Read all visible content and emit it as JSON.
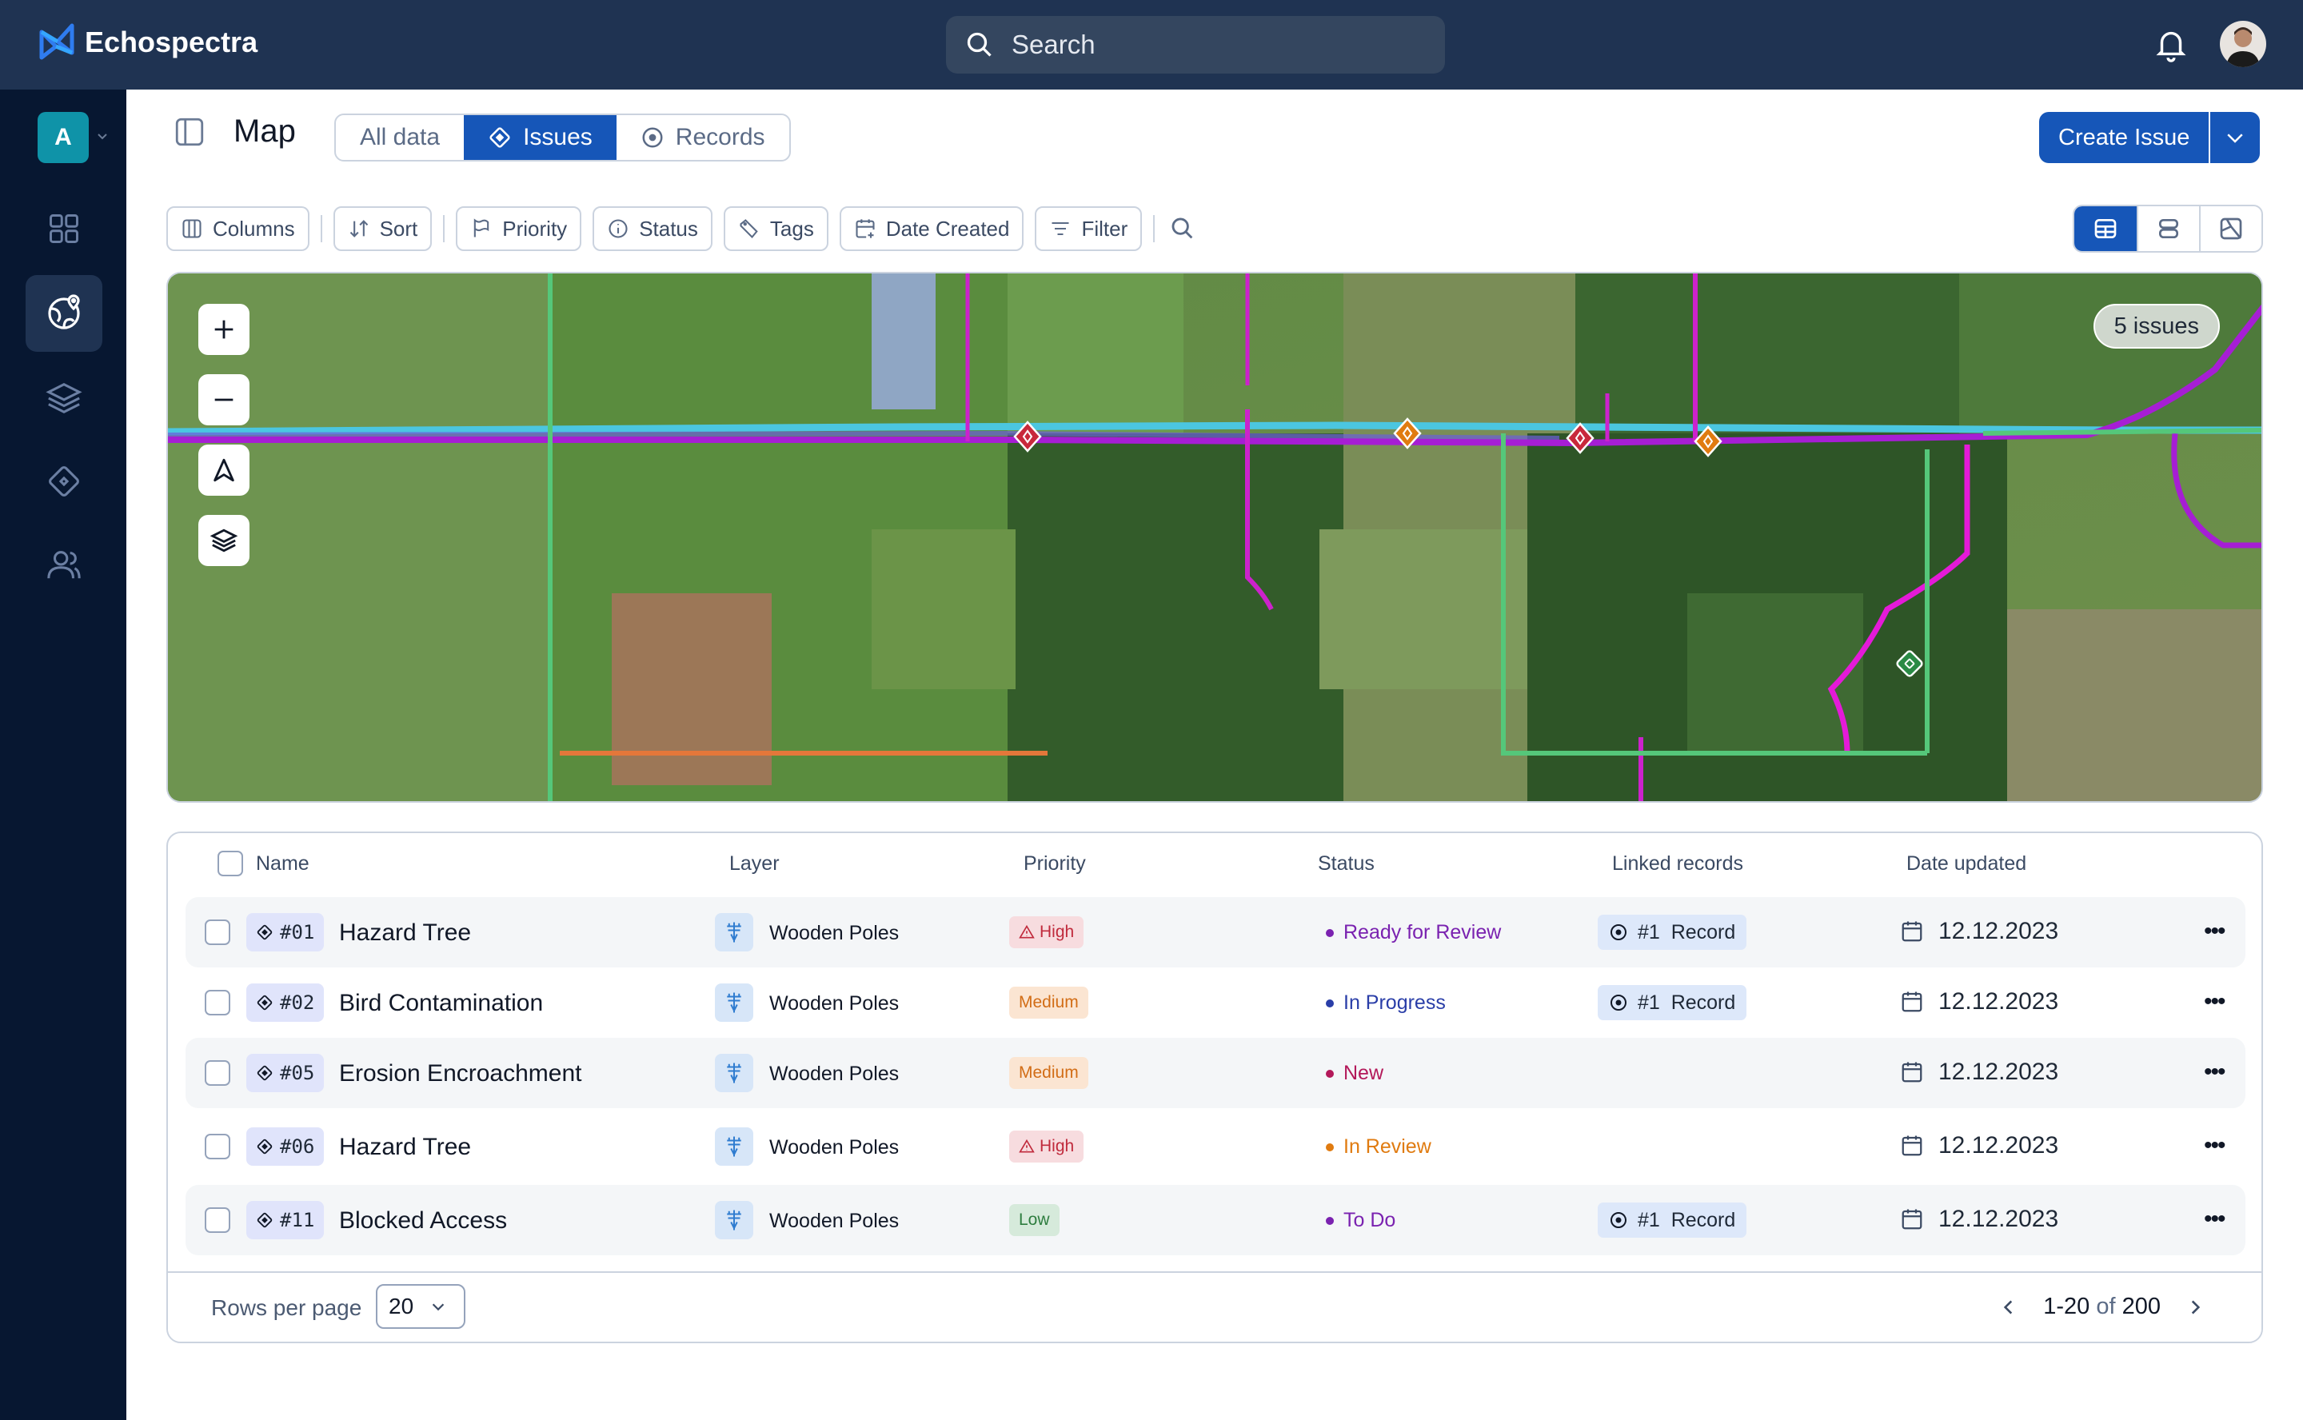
{
  "app": {
    "name": "Echospectra"
  },
  "topbar": {
    "search_placeholder": "Search"
  },
  "sidebar": {
    "workspace_initial": "A",
    "items": [
      {
        "name": "dashboard",
        "icon": "grid-icon",
        "active": false
      },
      {
        "name": "map",
        "icon": "globe-pin-icon",
        "active": true
      },
      {
        "name": "layers",
        "icon": "layers-icon",
        "active": false
      },
      {
        "name": "issues",
        "icon": "diamond-icon",
        "active": false
      },
      {
        "name": "users",
        "icon": "users-icon",
        "active": false
      }
    ]
  },
  "header": {
    "title": "Map",
    "tabs": [
      {
        "label": "All data",
        "active": false
      },
      {
        "label": "Issues",
        "active": true,
        "icon": "diamond-icon"
      },
      {
        "label": "Records",
        "active": false,
        "icon": "target-icon"
      }
    ],
    "create_button": "Create Issue"
  },
  "filters": {
    "columns": "Columns",
    "sort": "Sort",
    "priority": "Priority",
    "status": "Status",
    "tags": "Tags",
    "date_created": "Date Created",
    "filter": "Filter"
  },
  "map": {
    "issue_count_label": "5 issues",
    "markers": [
      {
        "priority": "high",
        "color": "#c8293b"
      },
      {
        "priority": "medium",
        "color": "#e07b10"
      },
      {
        "priority": "high",
        "color": "#c8293b"
      },
      {
        "priority": "medium",
        "color": "#e07b10"
      },
      {
        "priority": "low",
        "color": "#2a8a45"
      }
    ]
  },
  "table": {
    "columns": [
      "Name",
      "Layer",
      "Priority",
      "Status",
      "Linked records",
      "Date updated"
    ],
    "rows": [
      {
        "id": "#01",
        "name": "Hazard Tree",
        "layer": "Wooden Poles",
        "priority": "High",
        "priority_level": "high",
        "status": "Ready for Review",
        "status_color": "#7a22b0",
        "linked": "#1  Record",
        "date": "12.12.2023"
      },
      {
        "id": "#02",
        "name": "Bird Contamination",
        "layer": "Wooden Poles",
        "priority": "Medium",
        "priority_level": "medium",
        "status": "In Progress",
        "status_color": "#2a3ea8",
        "linked": "#1  Record",
        "date": "12.12.2023"
      },
      {
        "id": "#05",
        "name": "Erosion Encroachment",
        "layer": "Wooden Poles",
        "priority": "Medium",
        "priority_level": "medium",
        "status": "New",
        "status_color": "#b3195a",
        "linked": "",
        "date": "12.12.2023"
      },
      {
        "id": "#06",
        "name": "Hazard Tree",
        "layer": "Wooden Poles",
        "priority": "High",
        "priority_level": "high",
        "status": "In Review",
        "status_color": "#e07b10",
        "linked": "",
        "date": "12.12.2023"
      },
      {
        "id": "#11",
        "name": "Blocked Access",
        "layer": "Wooden Poles",
        "priority": "Low",
        "priority_level": "low",
        "status": "To Do",
        "status_color": "#7a22b0",
        "linked": "#1  Record",
        "date": "12.12.2023"
      }
    ]
  },
  "pagination": {
    "rows_per_page_label": "Rows per page",
    "rows_per_page": "20",
    "range": "1-20",
    "of": "of",
    "total": "200"
  }
}
